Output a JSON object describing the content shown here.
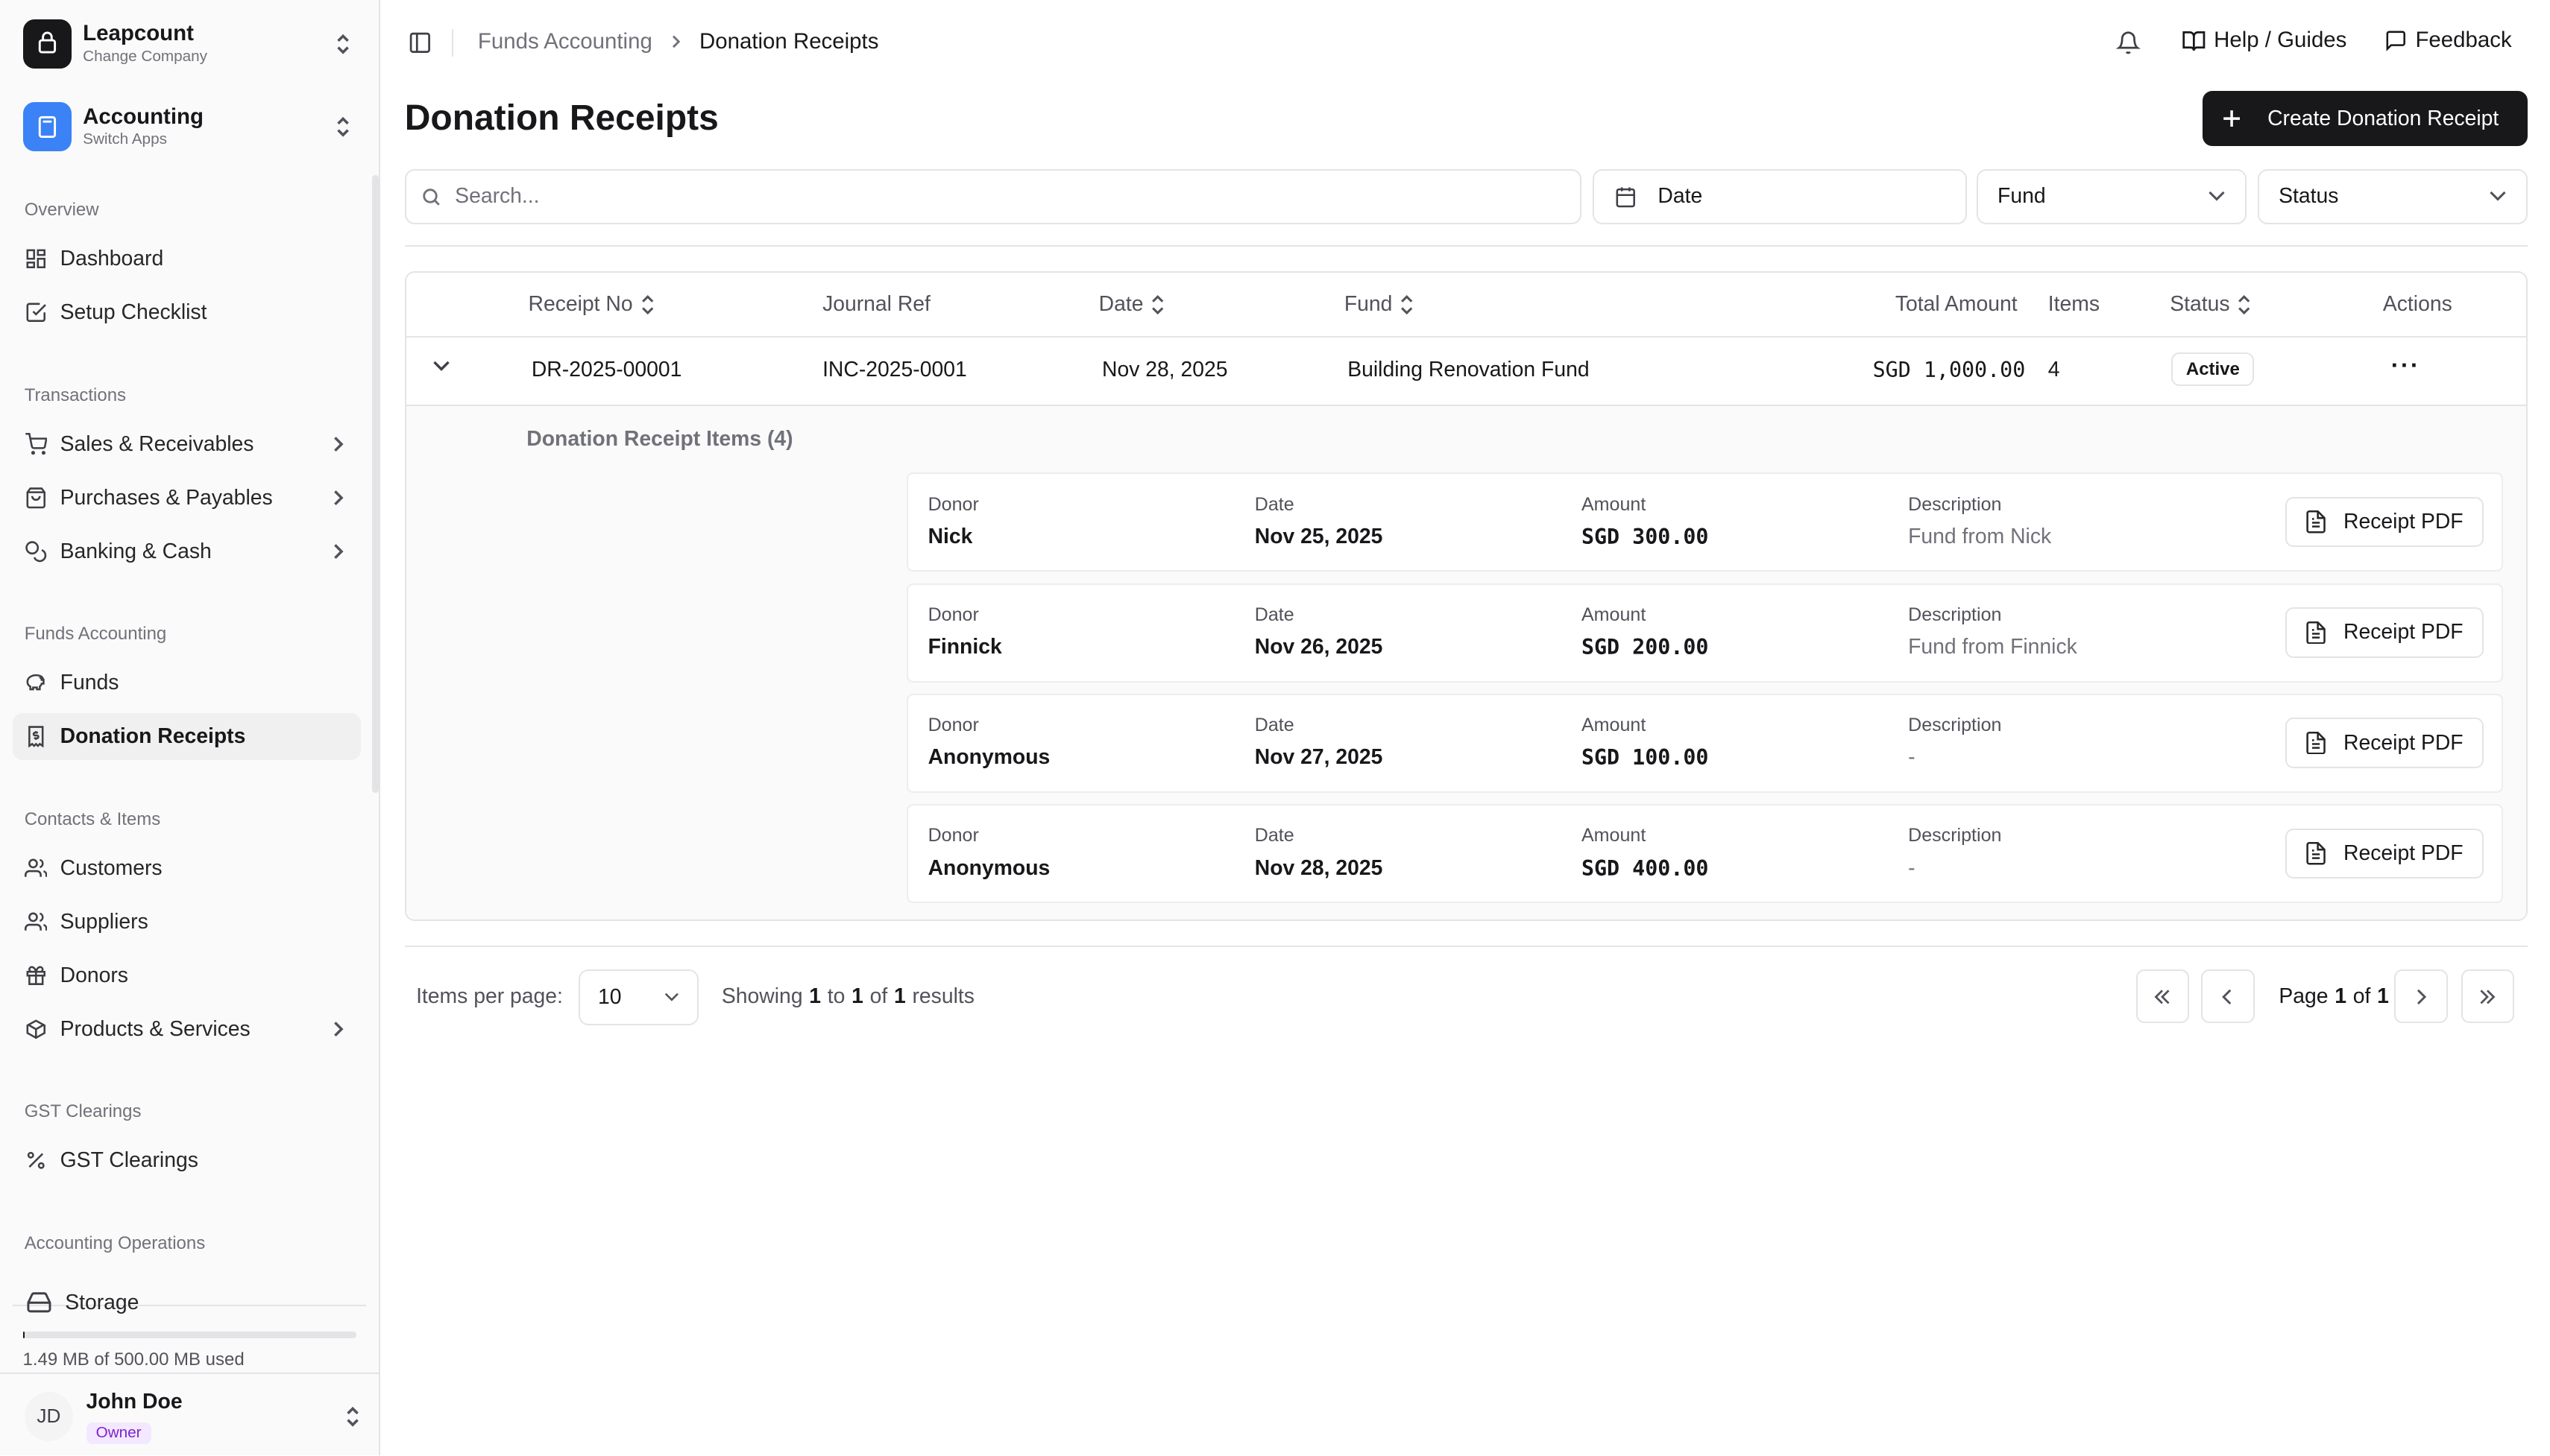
{
  "company": {
    "name": "Leapcount",
    "sub": "Change Company"
  },
  "app": {
    "name": "Accounting",
    "sub": "Switch Apps"
  },
  "sidebar": {
    "sections": {
      "overview": "Overview",
      "transactions": "Transactions",
      "funds": "Funds Accounting",
      "contacts": "Contacts & Items",
      "gst": "GST Clearings",
      "operations": "Accounting Operations"
    },
    "items": {
      "dashboard": "Dashboard",
      "setup": "Setup Checklist",
      "sales": "Sales & Receivables",
      "purchases": "Purchases & Payables",
      "banking": "Banking & Cash",
      "funds": "Funds",
      "donation_receipts": "Donation Receipts",
      "customers": "Customers",
      "suppliers": "Suppliers",
      "donors": "Donors",
      "products": "Products & Services",
      "gst_clearings": "GST Clearings"
    },
    "storage": {
      "label": "Storage",
      "used_text": "1.49 MB of 500.00 MB used",
      "used_fraction": 0.003
    },
    "user": {
      "initials": "JD",
      "name": "John Doe",
      "role": "Owner"
    }
  },
  "header": {
    "breadcrumb_parent": "Funds Accounting",
    "breadcrumb_current": "Donation Receipts",
    "help": "Help / Guides",
    "feedback": "Feedback"
  },
  "page": {
    "title": "Donation Receipts",
    "create_button": "Create Donation Receipt"
  },
  "filters": {
    "search_placeholder": "Search...",
    "date": "Date",
    "fund": "Fund",
    "status": "Status"
  },
  "table": {
    "columns": {
      "receipt_no": "Receipt No",
      "journal_ref": "Journal Ref",
      "date": "Date",
      "fund": "Fund",
      "total_amount": "Total Amount",
      "items": "Items",
      "status": "Status",
      "actions": "Actions"
    },
    "row": {
      "receipt_no": "DR-2025-00001",
      "journal_ref": "INC-2025-0001",
      "date": "Nov 28, 2025",
      "fund": "Building Renovation Fund",
      "total_amount": "SGD 1,000.00",
      "items": "4",
      "status": "Active",
      "actions": "···"
    },
    "items_title": "Donation Receipt Items (4)",
    "item_labels": {
      "donor": "Donor",
      "date": "Date",
      "amount": "Amount",
      "description": "Description",
      "pdf": "Receipt PDF"
    },
    "items": [
      {
        "donor": "Nick",
        "date": "Nov 25, 2025",
        "amount": "SGD 300.00",
        "description": "Fund from Nick"
      },
      {
        "donor": "Finnick",
        "date": "Nov 26, 2025",
        "amount": "SGD 200.00",
        "description": "Fund from Finnick"
      },
      {
        "donor": "Anonymous",
        "date": "Nov 27, 2025",
        "amount": "SGD 100.00",
        "description": "-"
      },
      {
        "donor": "Anonymous",
        "date": "Nov 28, 2025",
        "amount": "SGD 400.00",
        "description": "-"
      }
    ]
  },
  "pagination": {
    "items_per_page_label": "Items per page:",
    "items_per_page": "10",
    "showing_prefix": "Showing",
    "from": "1",
    "to_word": "to",
    "to": "1",
    "of_word": "of",
    "total": "1",
    "results_word": "results",
    "page_word": "Page",
    "current_page": "1",
    "total_pages": "1"
  },
  "colors": {
    "primary": "#18181b",
    "app_icon": "#3b82f6",
    "owner_badge": "#f3e8ff"
  }
}
